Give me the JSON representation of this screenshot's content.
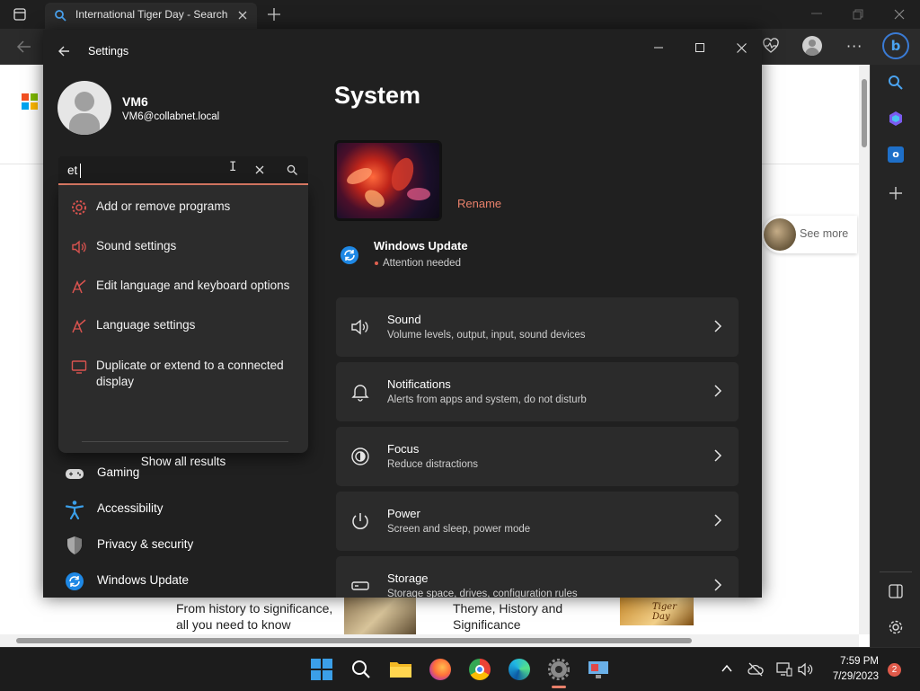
{
  "browser": {
    "tab_title": "International Tiger Day - Search",
    "page": {
      "see_more": "See more",
      "story1": "From history to significance, all you need to know",
      "story2": "Theme, History and Significance",
      "thumb_label": "Tiger Day"
    }
  },
  "settings": {
    "title": "Settings",
    "user": {
      "name": "VM6",
      "email": "VM6@collabnet.local"
    },
    "search": {
      "value": "et"
    },
    "suggestions": [
      {
        "label": "Add or remove programs",
        "icon": "gear-icon"
      },
      {
        "label": "Sound settings",
        "icon": "speaker-icon"
      },
      {
        "label": "Edit language and keyboard options",
        "icon": "language-icon"
      },
      {
        "label": "Language settings",
        "icon": "language-icon"
      },
      {
        "label": "Duplicate or extend to a connected display",
        "icon": "monitor-icon"
      }
    ],
    "show_all": "Show all results",
    "nav": [
      {
        "label": "Gaming",
        "icon": "gamepad-icon"
      },
      {
        "label": "Accessibility",
        "icon": "accessibility-icon"
      },
      {
        "label": "Privacy & security",
        "icon": "shield-icon"
      },
      {
        "label": "Windows Update",
        "icon": "update-icon"
      }
    ],
    "page_title": "System",
    "rename": "Rename",
    "update": {
      "title": "Windows Update",
      "status": "Attention needed"
    },
    "cards": [
      {
        "title": "Sound",
        "desc": "Volume levels, output, input, sound devices",
        "icon": "speaker-icon"
      },
      {
        "title": "Notifications",
        "desc": "Alerts from apps and system, do not disturb",
        "icon": "bell-icon"
      },
      {
        "title": "Focus",
        "desc": "Reduce distractions",
        "icon": "focus-icon"
      },
      {
        "title": "Power",
        "desc": "Screen and sleep, power mode",
        "icon": "power-icon"
      },
      {
        "title": "Storage",
        "desc": "Storage space, drives, configuration rules",
        "icon": "storage-icon"
      }
    ]
  },
  "taskbar": {
    "time": "7:59 PM",
    "date": "7/29/2023",
    "notification_count": "2"
  },
  "colors": {
    "accent": "#e8806a",
    "status_dot": "#e06050",
    "windows_blue": "#3b9fe8"
  }
}
